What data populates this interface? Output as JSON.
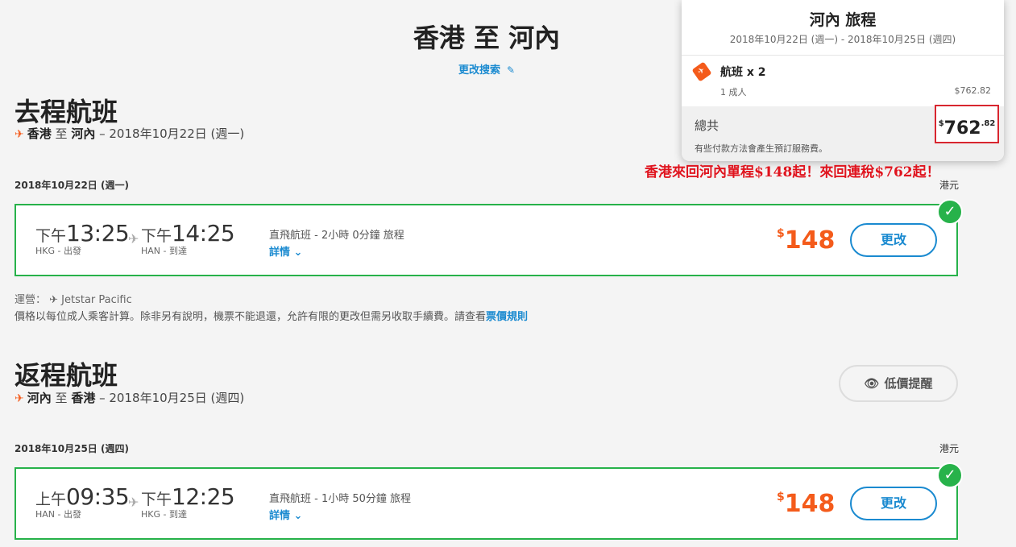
{
  "header": {
    "title": "香港 至 河內",
    "modify_search": "更改搜索"
  },
  "outbound": {
    "section_title": "去程航班",
    "route_from": "香港",
    "route_to_word": "至",
    "route_to": "河內",
    "route_date": "– 2018年10月22日 (週一)",
    "date_head": "2018年10月22日 (週一)",
    "currency": "港元",
    "dep_period": "下午",
    "dep_time": "13:25",
    "dep_sub": "HKG - 出發",
    "arr_period": "下午",
    "arr_time": "14:25",
    "arr_sub": "HAN - 到達",
    "info": "直飛航班 - 2小時 0分鐘 旅程",
    "details": "詳情 ⌄",
    "price_symbol": "$",
    "price": "148",
    "change": "更改",
    "operator": "運營： ✈ Jetstar Pacific",
    "fare_note": "價格以每位成人乘客計算。除非另有說明，機票不能退還，允許有限的更改但需另收取手續費。請查看",
    "fare_link": "票價規則"
  },
  "inbound": {
    "section_title": "返程航班",
    "route_from": "河內",
    "route_to_word": "至",
    "route_to": "香港",
    "route_date": "– 2018年10月25日 (週四)",
    "date_head": "2018年10月25日 (週四)",
    "currency": "港元",
    "dep_period": "上午",
    "dep_time": "09:35",
    "dep_sub": "HAN - 出發",
    "arr_period": "下午",
    "arr_time": "12:25",
    "arr_sub": "HKG - 到達",
    "info": "直飛航班 - 1小時 50分鐘 旅程",
    "details": "詳情 ⌄",
    "price_symbol": "$",
    "price": "148",
    "change": "更改",
    "price_alert": "低價提醒"
  },
  "summary": {
    "title": "河內 旅程",
    "dates": "2018年10月22日 (週一) - 2018年10月25日 (週四)",
    "flights": "航班 x 2",
    "pax": "1 成人",
    "pax_price": "$762.82",
    "total_label": "總共",
    "total_symbol": "$",
    "total_main": "762",
    "total_cents": ".82",
    "fee_note": "有些付款方法會產生預訂服務費。"
  },
  "promo": "香港來回河內單程$148起！來回連稅$762起！",
  "colors": {
    "accent_blue": "#1a8ad0",
    "price_orange": "#f45b1b",
    "selected_green": "#27b24a",
    "promo_red": "#e0141e"
  }
}
